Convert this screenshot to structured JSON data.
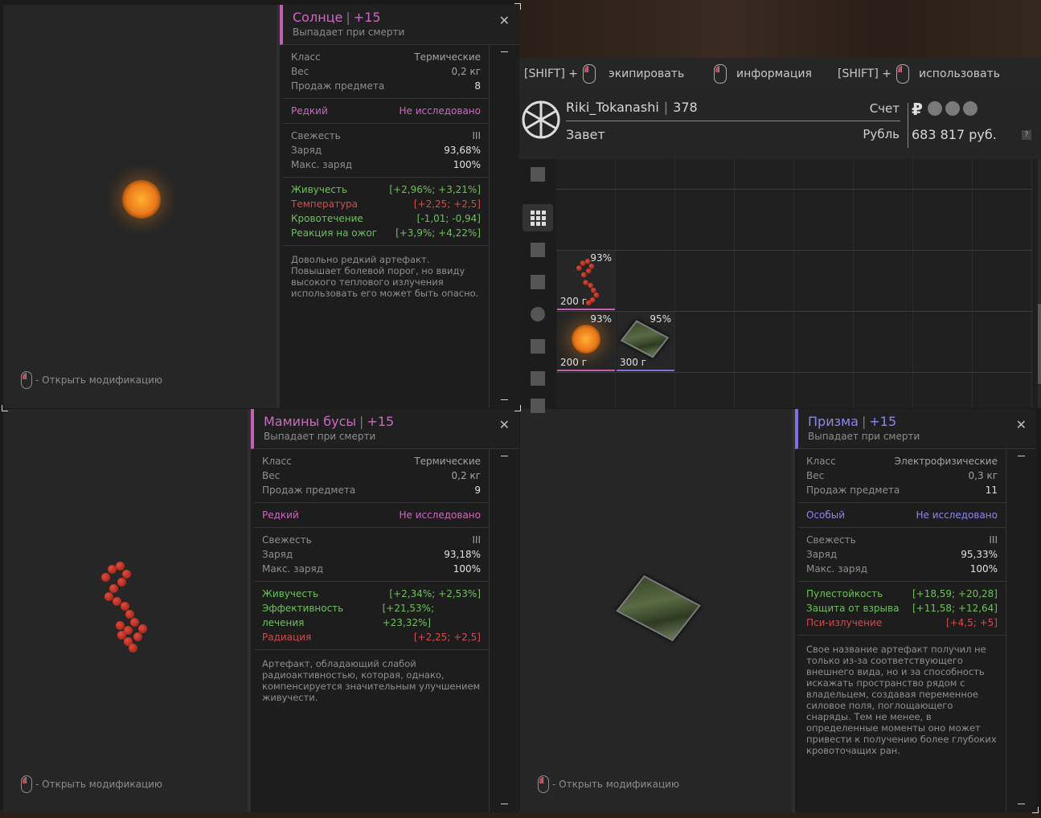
{
  "panels": {
    "sun": {
      "title": "Солнце",
      "level": "+15",
      "subtitle": "Выпадает при смерти",
      "rows1": [
        {
          "label": "Класс",
          "value": "Термические"
        },
        {
          "label": "Вес",
          "value": "0,2 кг"
        },
        {
          "label": "Продаж предмета",
          "value": "8"
        }
      ],
      "rarity": "Редкий",
      "research": "Не исследовано",
      "rows2": [
        {
          "label": "Свежесть",
          "value": "III"
        },
        {
          "label": "Заряд",
          "value": "93,68%"
        },
        {
          "label": "Макс. заряд",
          "value": "100%"
        }
      ],
      "stats": [
        {
          "label": "Живучесть",
          "value": "[+2,96%; +3,21%]",
          "tone": "good"
        },
        {
          "label": "Температура",
          "value": "[+2,25; +2,5]",
          "tone": "bad"
        },
        {
          "label": "Кровотечение",
          "value": "[-1,01; -0,94]",
          "tone": "good"
        },
        {
          "label": "Реакция на ожог",
          "value": "[+3,9%; +4,22%]",
          "tone": "good"
        }
      ],
      "description": "Довольно редкий артефакт. Повышает болевой порог, но ввиду высокого теплового излучения использовать его может быть опасно.",
      "open_mod": "- Открыть модификацию"
    },
    "beads": {
      "title": "Мамины бусы",
      "level": "+15",
      "subtitle": "Выпадает при смерти",
      "rows1": [
        {
          "label": "Класс",
          "value": "Термические"
        },
        {
          "label": "Вес",
          "value": "0,2 кг"
        },
        {
          "label": "Продаж предмета",
          "value": "9"
        }
      ],
      "rarity": "Редкий",
      "research": "Не исследовано",
      "rows2": [
        {
          "label": "Свежесть",
          "value": "III"
        },
        {
          "label": "Заряд",
          "value": "93,18%"
        },
        {
          "label": "Макс. заряд",
          "value": "100%"
        }
      ],
      "stats": [
        {
          "label": "Живучесть",
          "value": "[+2,34%; +2,53%]",
          "tone": "good"
        },
        {
          "label": "Эффективность лечения",
          "value": "[+21,53%; +23,32%]",
          "tone": "good"
        },
        {
          "label": "Радиация",
          "value": "[+2,25; +2,5]",
          "tone": "bad"
        }
      ],
      "description": "Артефакт, обладающий слабой радиоактивностью, которая, однако, компенсируется значительным улучшением живучести.",
      "open_mod": "- Открыть модификацию"
    },
    "prism": {
      "title": "Призма",
      "level": "+15",
      "subtitle": "Выпадает при смерти",
      "rows1": [
        {
          "label": "Класс",
          "value": "Электрофизические"
        },
        {
          "label": "Вес",
          "value": "0,3 кг"
        },
        {
          "label": "Продаж предмета",
          "value": "11"
        }
      ],
      "rarity": "Особый",
      "research": "Не исследовано",
      "rows2": [
        {
          "label": "Свежесть",
          "value": "III"
        },
        {
          "label": "Заряд",
          "value": "95,33%"
        },
        {
          "label": "Макс. заряд",
          "value": "100%"
        }
      ],
      "stats": [
        {
          "label": "Пулестойкость",
          "value": "[+18,59; +20,28]",
          "tone": "good"
        },
        {
          "label": "Защита от взрыва",
          "value": "[+11,58; +12,64]",
          "tone": "good"
        },
        {
          "label": "Пси-излучение",
          "value": "[+4,5; +5]",
          "tone": "bad"
        }
      ],
      "description": "Свое название артефакт получил не только из-за соответствующего внешнего вида, но и за способность искажать пространство рядом с владельцем, создавая переменное силовое поля, поглощающего снаряды. Тем не менее, в определенные моменты оно может привести к получению более глубоких кровоточащих ран.",
      "open_mod": "- Открыть модификацию"
    }
  },
  "inventory": {
    "hints": {
      "shift1": "[SHIFT] +",
      "equip": "экипировать",
      "info": "информация",
      "shift2": "[SHIFT] +",
      "use": "использовать"
    },
    "profile": {
      "name": "Riki_Tokanashi",
      "level": "378",
      "faction": "Завет",
      "account_label": "Счет",
      "currency_label": "Рубль",
      "money": "683 817 руб.",
      "help": "?"
    },
    "items": [
      {
        "name": "Мамины бусы",
        "charge": "93%",
        "weight": "200 г",
        "rarity": "rare"
      },
      {
        "name": "Солнце",
        "charge": "93%",
        "weight": "200 г",
        "rarity": "rare"
      },
      {
        "name": "Призма",
        "charge": "95%",
        "weight": "300 г",
        "rarity": "special"
      }
    ],
    "icons": [
      "sort-icon",
      "grid-icon",
      "backpack-icon",
      "rifle-icon",
      "artifact-icon",
      "medkit-icon",
      "ammo-icon",
      "tools-icon"
    ]
  },
  "colors": {
    "rare": "#c45fb5",
    "special": "#7a73e0",
    "good": "#6ec05a",
    "bad": "#d04d4d"
  }
}
